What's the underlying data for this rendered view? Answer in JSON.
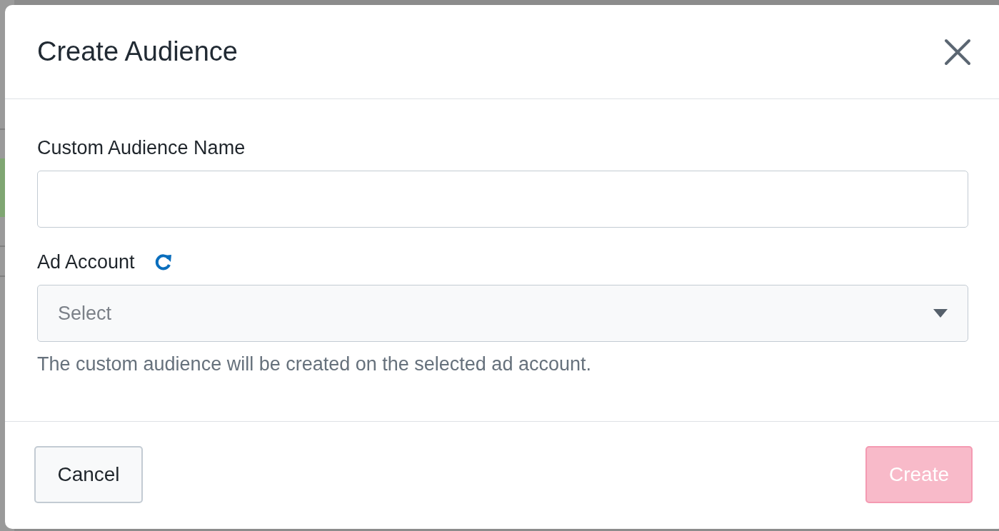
{
  "dialog": {
    "title": "Create Audience"
  },
  "fields": [
    {
      "kind": "text",
      "label": "Custom Audience Name"
    },
    {
      "kind": "select",
      "label": "Ad Account",
      "placeholder": "Select",
      "help": "The custom audience will be created on the selected ad account."
    }
  ],
  "buttons": [
    {
      "kind": "secondary",
      "label": "Cancel",
      "disabled": false
    },
    {
      "kind": "primary",
      "label": "Create",
      "disabled": true
    }
  ]
}
